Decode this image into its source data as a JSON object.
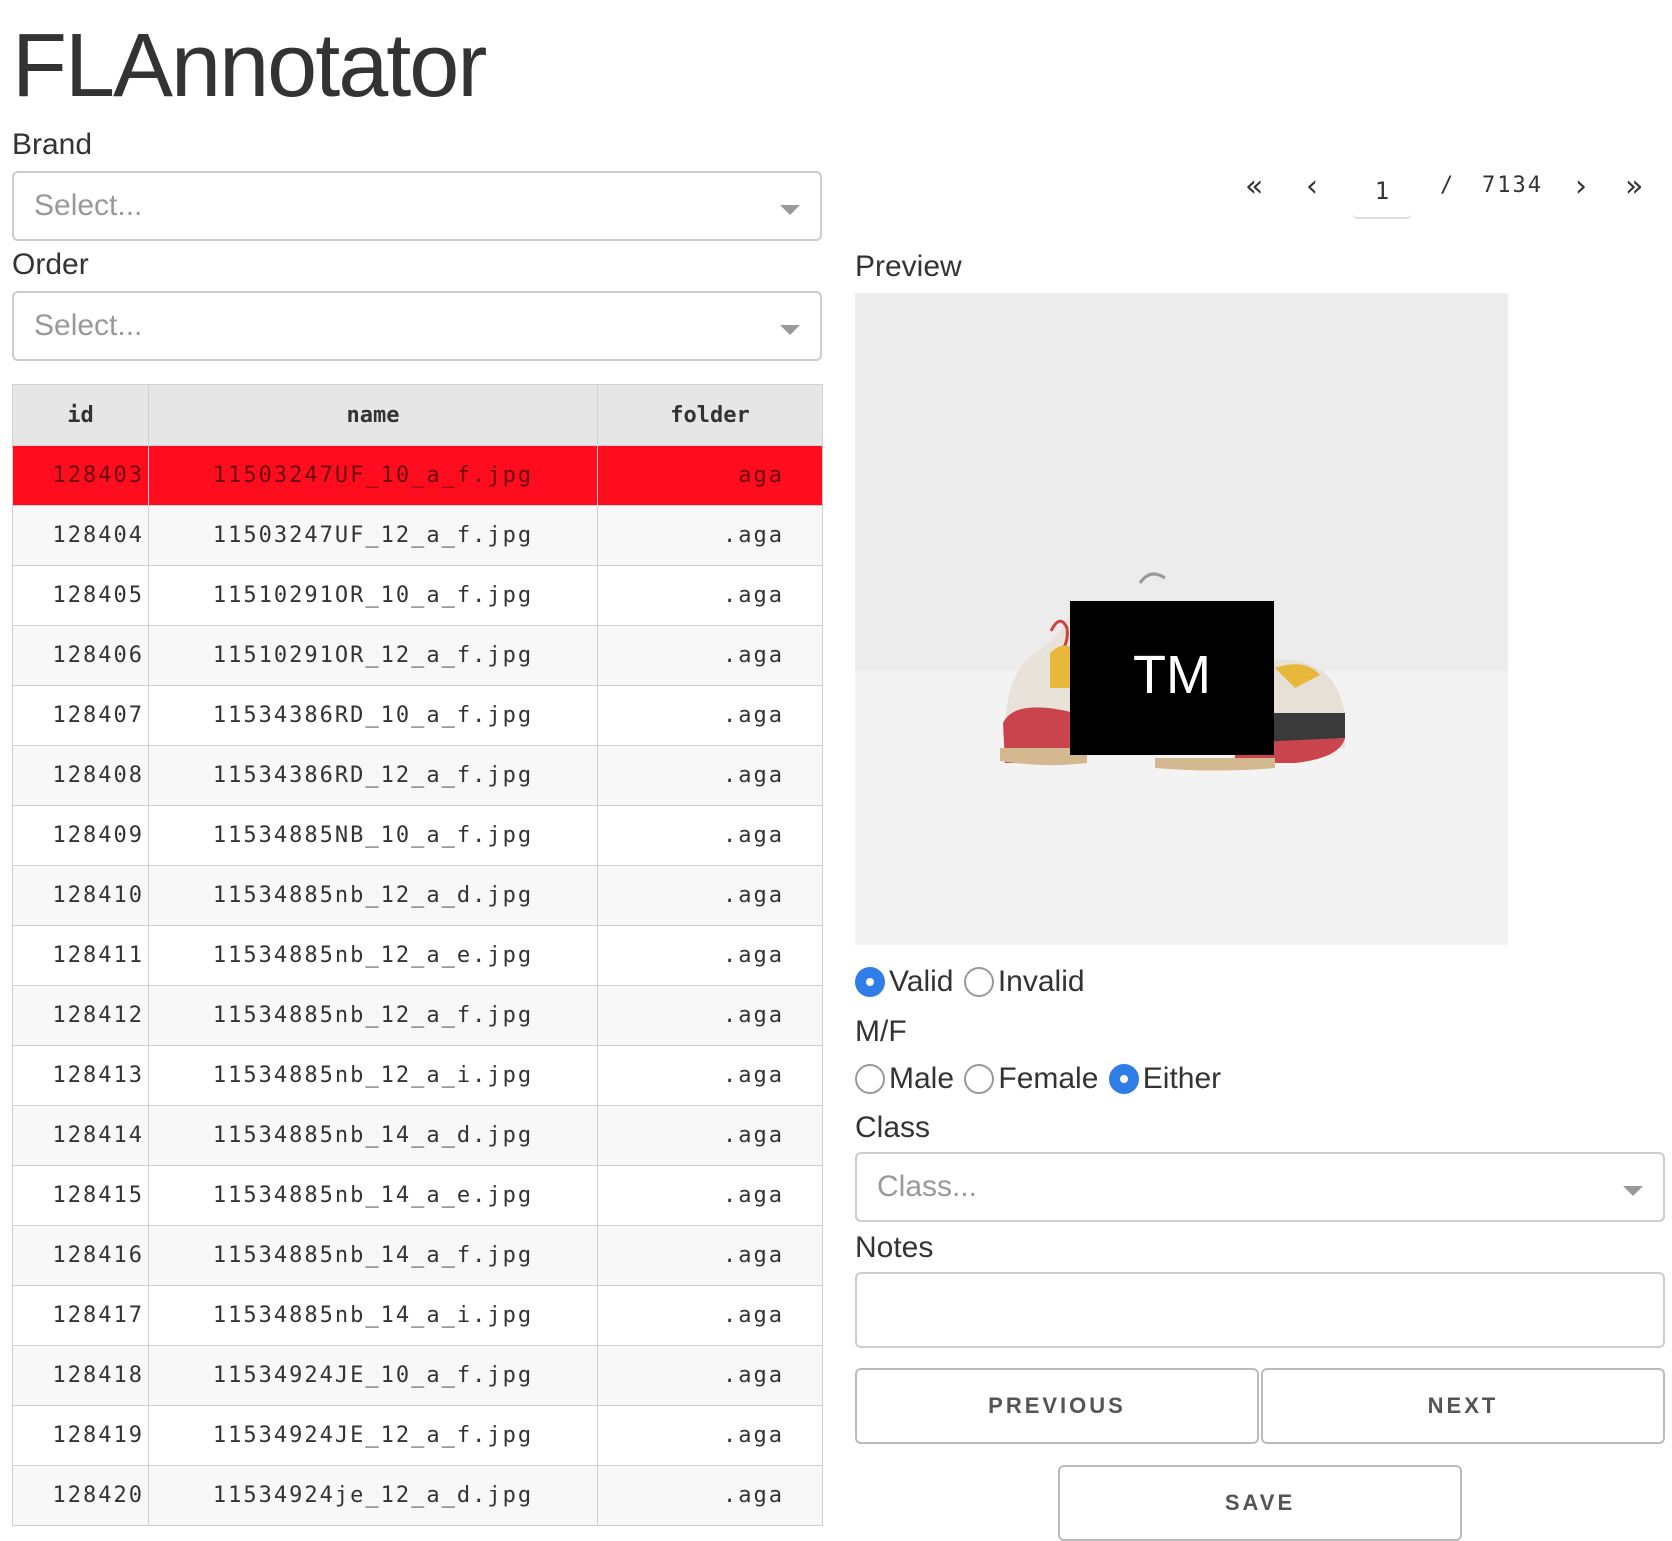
{
  "app": {
    "title": "FLAnnotator"
  },
  "filters": {
    "brand_label": "Brand",
    "brand_placeholder": "Select...",
    "order_label": "Order",
    "order_placeholder": "Select..."
  },
  "table": {
    "columns": [
      "id",
      "name",
      "folder"
    ],
    "selected_index": 0,
    "rows": [
      {
        "id": "128403",
        "name": "11503247UF_10_a_f.jpg",
        "folder": "aga"
      },
      {
        "id": "128404",
        "name": "11503247UF_12_a_f.jpg",
        "folder": ".aga"
      },
      {
        "id": "128405",
        "name": "11510291OR_10_a_f.jpg",
        "folder": ".aga"
      },
      {
        "id": "128406",
        "name": "11510291OR_12_a_f.jpg",
        "folder": ".aga"
      },
      {
        "id": "128407",
        "name": "11534386RD_10_a_f.jpg",
        "folder": ".aga"
      },
      {
        "id": "128408",
        "name": "11534386RD_12_a_f.jpg",
        "folder": ".aga"
      },
      {
        "id": "128409",
        "name": "11534885NB_10_a_f.jpg",
        "folder": ".aga"
      },
      {
        "id": "128410",
        "name": "11534885nb_12_a_d.jpg",
        "folder": ".aga"
      },
      {
        "id": "128411",
        "name": "11534885nb_12_a_e.jpg",
        "folder": ".aga"
      },
      {
        "id": "128412",
        "name": "11534885nb_12_a_f.jpg",
        "folder": ".aga"
      },
      {
        "id": "128413",
        "name": "11534885nb_12_a_i.jpg",
        "folder": ".aga"
      },
      {
        "id": "128414",
        "name": "11534885nb_14_a_d.jpg",
        "folder": ".aga"
      },
      {
        "id": "128415",
        "name": "11534885nb_14_a_e.jpg",
        "folder": ".aga"
      },
      {
        "id": "128416",
        "name": "11534885nb_14_a_f.jpg",
        "folder": ".aga"
      },
      {
        "id": "128417",
        "name": "11534885nb_14_a_i.jpg",
        "folder": ".aga"
      },
      {
        "id": "128418",
        "name": "11534924JE_10_a_f.jpg",
        "folder": ".aga"
      },
      {
        "id": "128419",
        "name": "11534924JE_12_a_f.jpg",
        "folder": ".aga"
      },
      {
        "id": "128420",
        "name": "11534924je_12_a_d.jpg",
        "folder": ".aga"
      }
    ]
  },
  "pagination": {
    "first_icon": "double-chevron-left-icon",
    "prev_icon": "chevron-left-icon",
    "next_icon": "chevron-right-icon",
    "last_icon": "double-chevron-right-icon",
    "current_page": "1",
    "separator": "/",
    "total_pages": "7134"
  },
  "preview": {
    "label": "Preview",
    "logo_text": "TM"
  },
  "validity": {
    "options": [
      "Valid",
      "Invalid"
    ],
    "selected": "Valid"
  },
  "gender": {
    "label": "M/F",
    "options": [
      "Male",
      "Female",
      "Either"
    ],
    "selected": "Either"
  },
  "class_field": {
    "label": "Class",
    "placeholder": "Class..."
  },
  "notes": {
    "label": "Notes",
    "value": ""
  },
  "buttons": {
    "previous": "PREVIOUS",
    "next": "NEXT",
    "save": "SAVE"
  },
  "colors": {
    "selected_row": "#ff0d1f",
    "radio_accent": "#2f7ee8"
  }
}
